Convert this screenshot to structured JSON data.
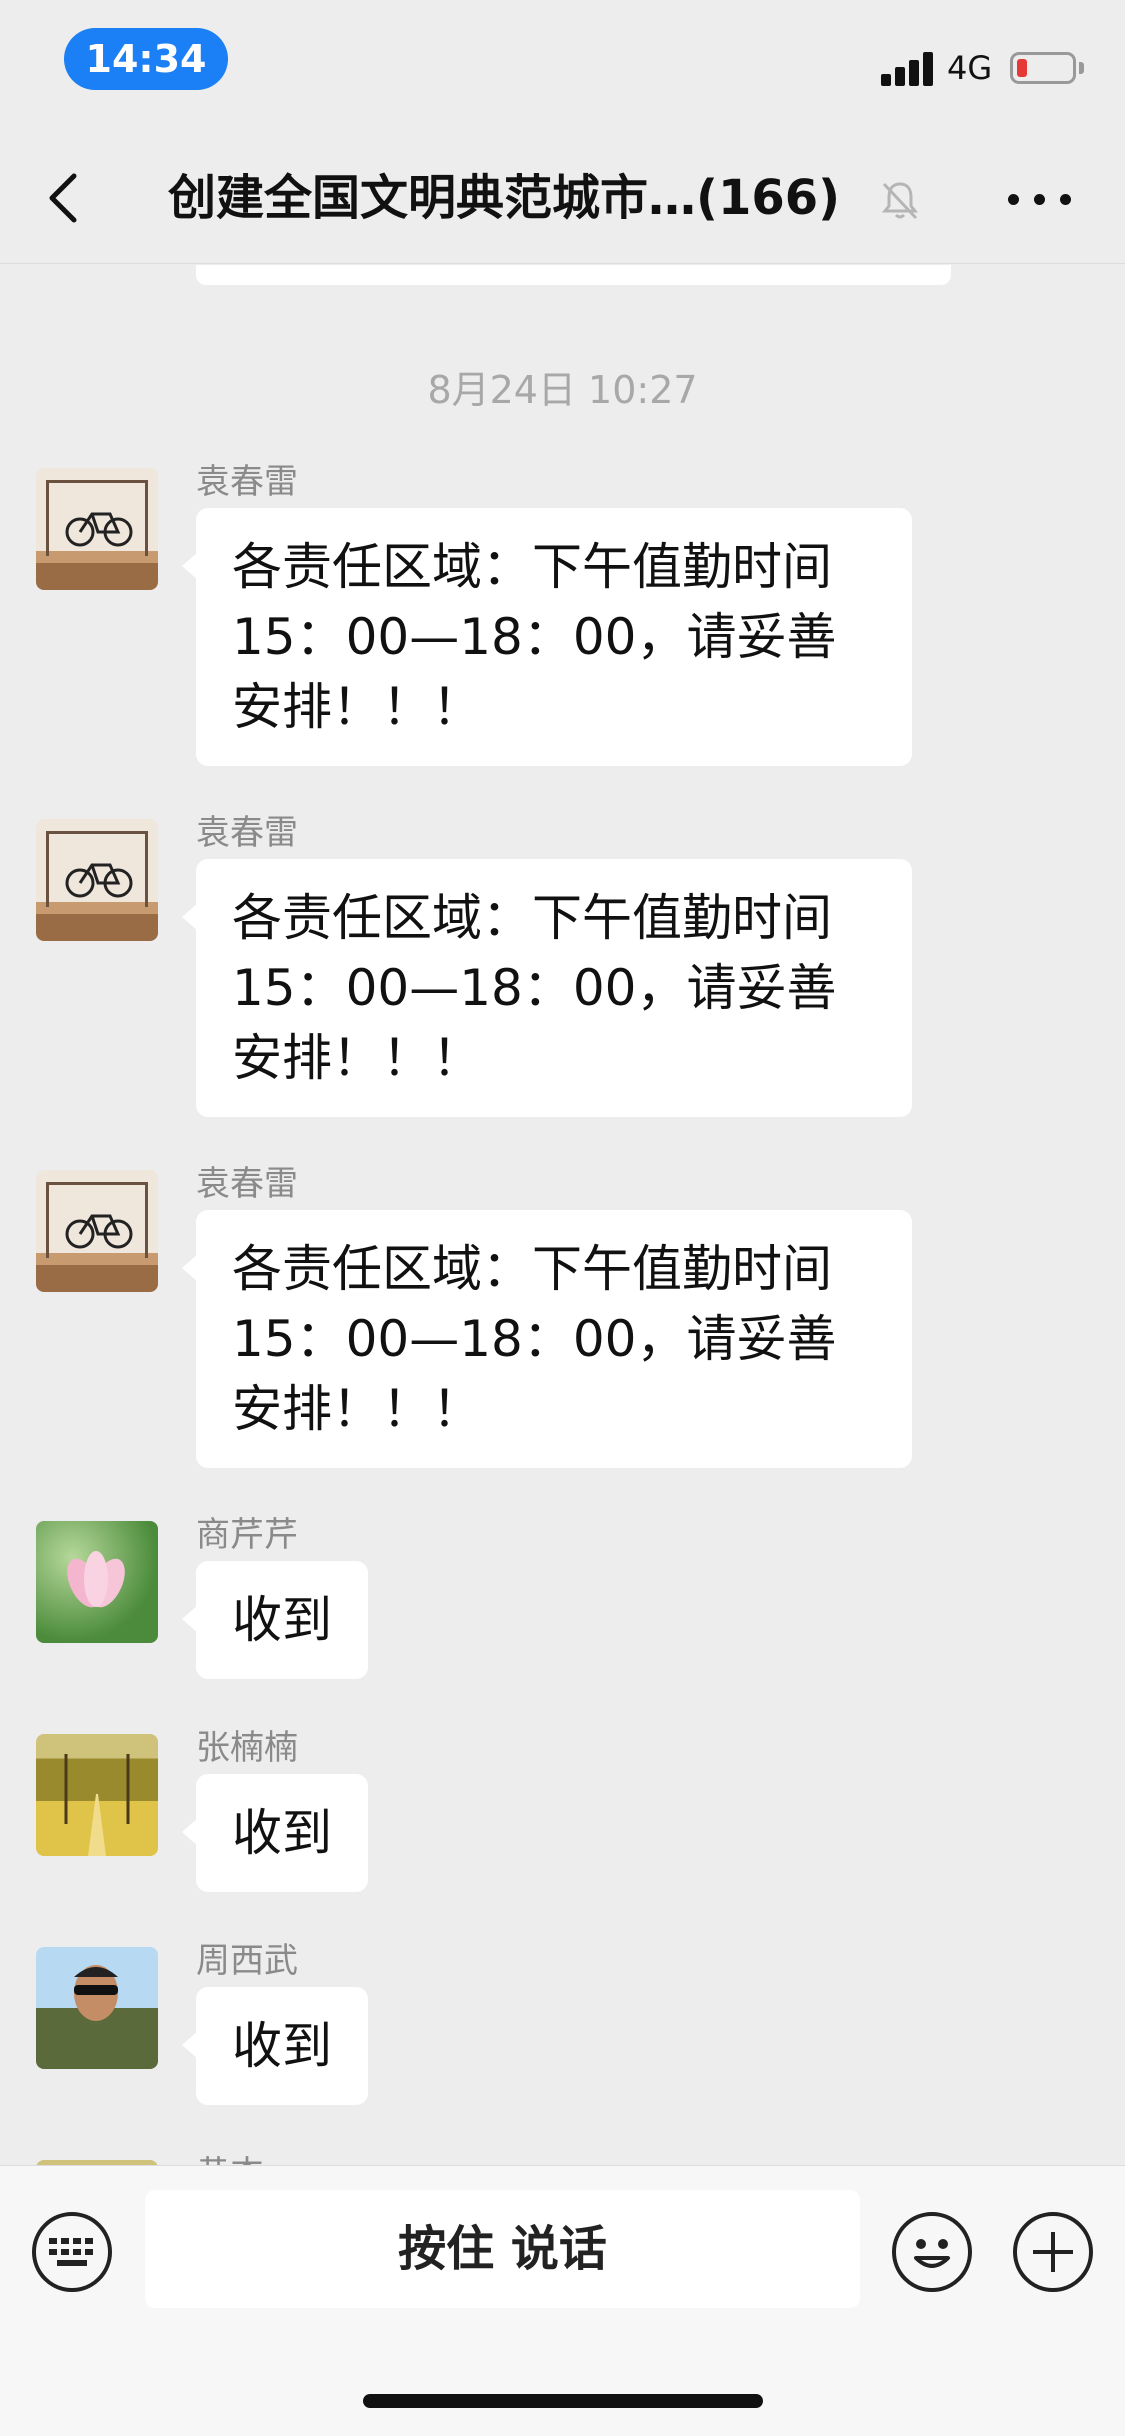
{
  "status_bar": {
    "time": "14:34",
    "network": "4G"
  },
  "nav": {
    "title": "创建全国文明典范城市…(166)",
    "back_icon": "chevron-left-icon",
    "mute_icon": "bell-muted-icon",
    "more_icon": "more-dots-icon"
  },
  "partial_top_bubble": "",
  "timestamp": "8月24日 10:27",
  "messages": [
    {
      "sender": "袁春雷",
      "avatar": "bicycle-avatar",
      "text": "各责任区域：下午值勤时间15：00—18：00，请妥善安排！！！"
    },
    {
      "sender": "袁春雷",
      "avatar": "bicycle-avatar",
      "text": "各责任区域：下午值勤时间15：00—18：00，请妥善安排！！！"
    },
    {
      "sender": "袁春雷",
      "avatar": "bicycle-avatar",
      "text": "各责任区域：下午值勤时间15：00—18：00，请妥善安排！！！"
    },
    {
      "sender": "商芹芹",
      "avatar": "lotus-avatar",
      "text": "收到"
    },
    {
      "sender": "张楠楠",
      "avatar": "tree-avenue-avatar",
      "text": "收到"
    },
    {
      "sender": "周西武",
      "avatar": "man-sunglasses-avatar",
      "text": "收到"
    },
    {
      "sender": "黄杰",
      "avatar": "partial-avatar",
      "text": ""
    }
  ],
  "input_bar": {
    "voice_label": "按住 说话",
    "keyboard_icon": "keyboard-icon",
    "emoji_icon": "emoji-icon",
    "plus_icon": "plus-icon"
  }
}
